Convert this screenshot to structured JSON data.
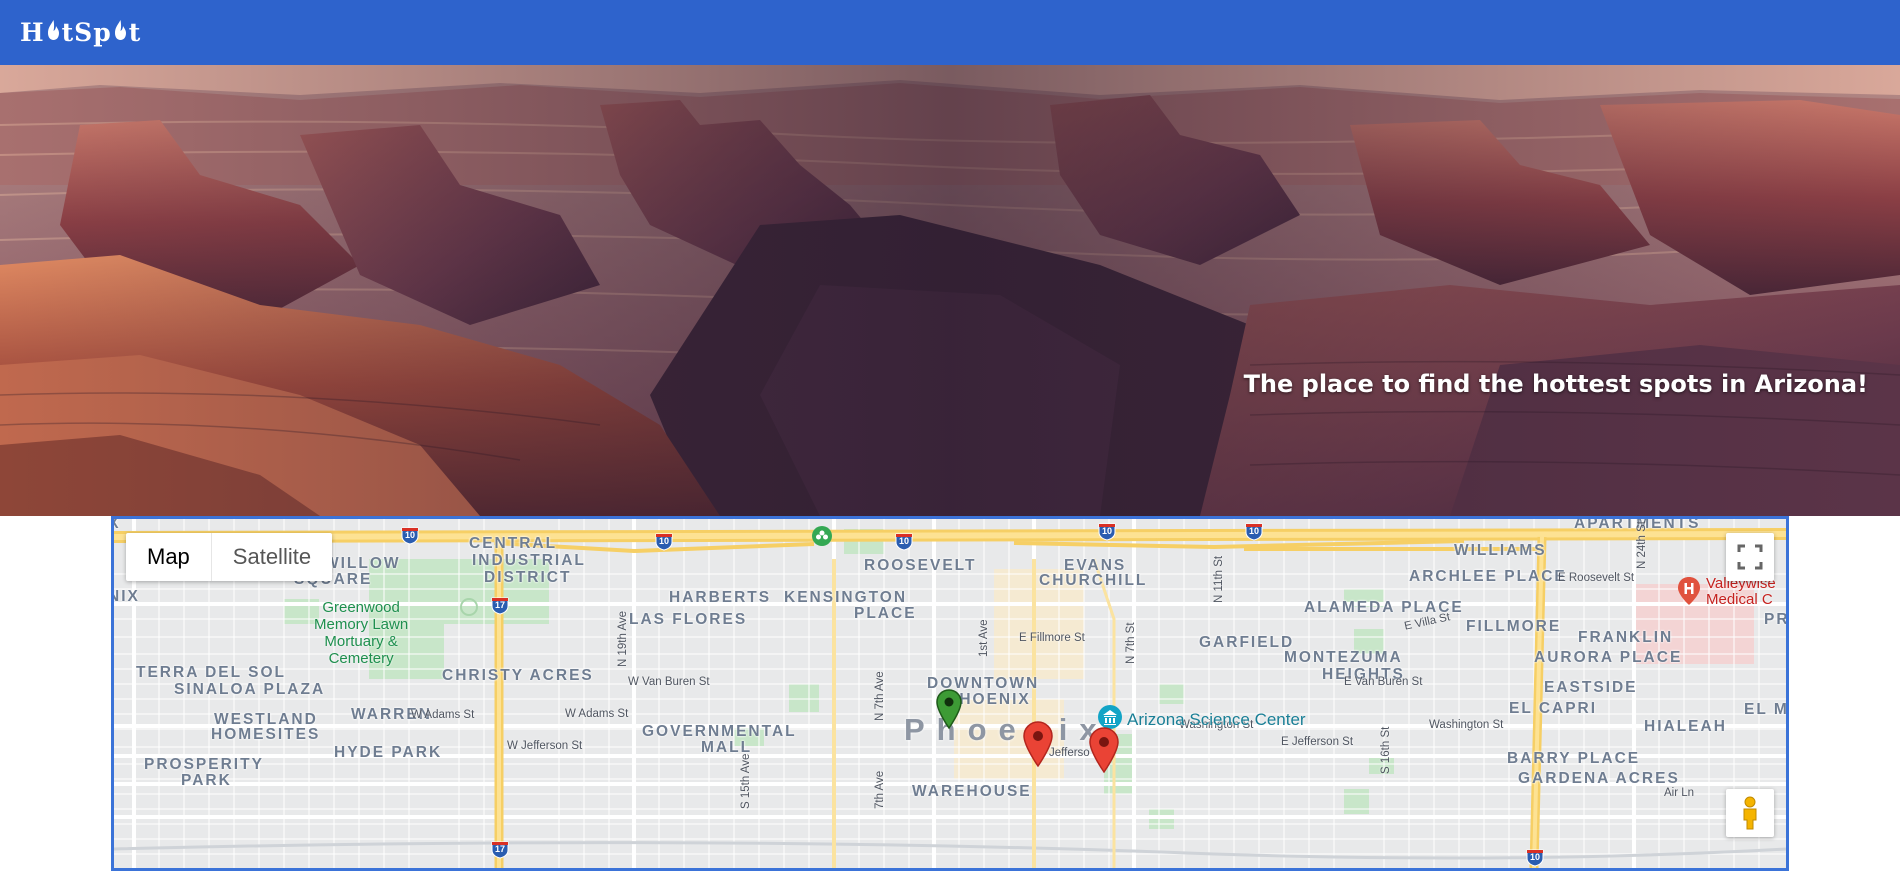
{
  "header": {
    "logo_parts": [
      "H",
      "tSp",
      "t"
    ],
    "logo_text": "HotSpot",
    "background_color": "#2e63cc"
  },
  "hero": {
    "tagline": "The place to find the hottest spots in Arizona!",
    "image_subject": "Grand Canyon"
  },
  "map": {
    "controls": {
      "map_label": "Map",
      "satellite_label": "Satellite",
      "active": "Map",
      "fullscreen_icon": "fullscreen-icon",
      "pegman_icon": "street-view-pegman-icon"
    },
    "city_label": "Phoenix",
    "neighborhoods": [
      "APARTMENTS",
      "CENTRAL",
      "INDUSTRIAL",
      "DISTRICT",
      "WILLOW",
      "SQUARE",
      "ROOSEVELT",
      "EVANS",
      "CHURCHILL",
      "WILLIAMS",
      "ARCHLEE PLACE",
      "HARBERTS",
      "KENSINGTON",
      "PLACE",
      "LAS FLORES",
      "ALAMEDA PLACE",
      "FILLMORE",
      "FRANKLIN",
      "GARFIELD",
      "MONTEZUMA",
      "HEIGHTS",
      "AURORA PLACE",
      "TERRA DEL SOL",
      "SINALOA PLAZA",
      "CHRISTY ACRES",
      "DOWNTOWN",
      "PHOENIX",
      "EASTSIDE",
      "WESTLAND",
      "HOMESITES",
      "WARREN",
      "GOVERNMENTAL",
      "MALL",
      "EL CAPRI",
      "EL M",
      "HIALEAH",
      "HYDE PARK",
      "PROSPERITY",
      "PARK",
      "BARRY PLACE",
      "GARDENA ACRES",
      "WAREHOUSE",
      "IX",
      "NIX",
      "PR"
    ],
    "streets": [
      "N 19th Ave",
      "1st Ave",
      "N 7th St",
      "N 11th St",
      "N 24th St",
      "E Roosevelt St",
      "E Villa St",
      "E Fillmore St",
      "W Van Buren St",
      "E Van Buren St",
      "W Adams St",
      "Washington St",
      "E Jefferson St",
      "W Jefferson St",
      "N 7th Ave",
      "S 15th Ave",
      "7th Ave",
      "S 16th St",
      "Jefferso",
      "Air Ln"
    ],
    "pois": [
      {
        "name": "Greenwood\nMemory Lawn\nMortuary &\nCemetery",
        "icon": "cemetery-icon"
      },
      {
        "name": "Arizona Science Center",
        "icon": "museum-icon"
      },
      {
        "name": "Valleywise\nMedical C",
        "icon": "hospital-icon"
      }
    ],
    "highway_shields": [
      "10",
      "10",
      "10",
      "10",
      "10",
      "17",
      "17",
      "10"
    ],
    "markers": [
      {
        "color": "#3d9b35",
        "label": "green-marker"
      },
      {
        "color": "#ea4335",
        "label": "red-marker"
      },
      {
        "color": "#ea4335",
        "label": "red-marker"
      }
    ]
  }
}
